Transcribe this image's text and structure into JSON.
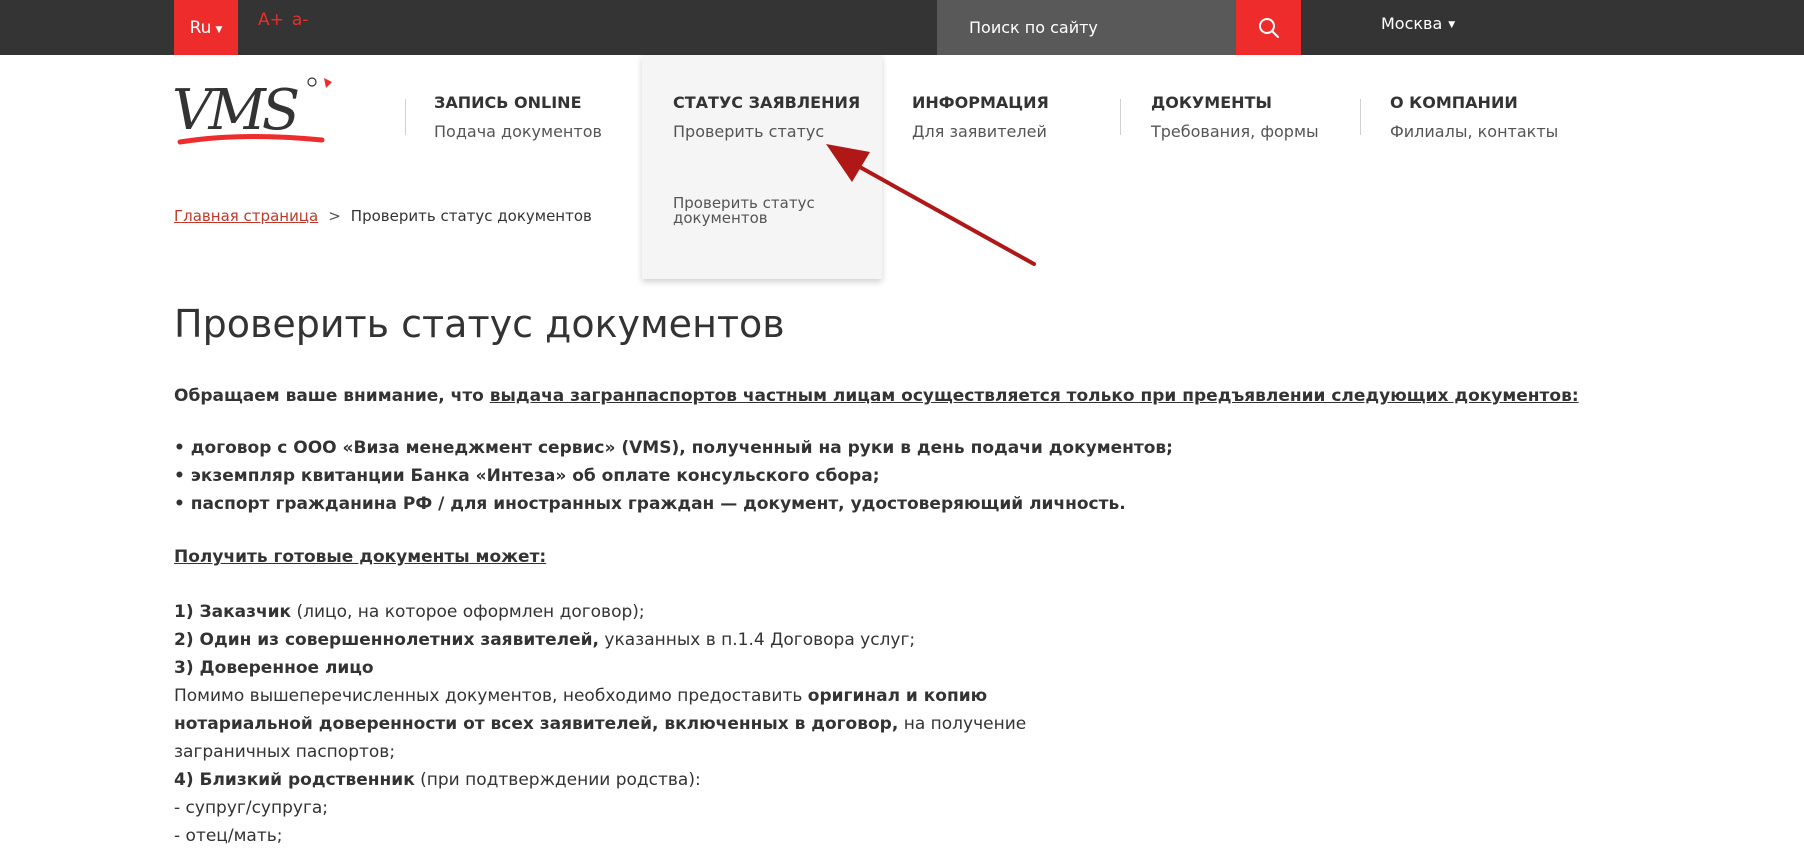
{
  "topbar": {
    "lang": "Ru",
    "font_increase": "A+",
    "font_decrease": "a-",
    "search_placeholder": "Поиск по сайту",
    "city": "Москва"
  },
  "colors": {
    "accent": "#ee2c2c",
    "topbar": "#343434",
    "search_bg": "#595959"
  },
  "logo_text": "VMS",
  "nav": [
    {
      "title": "ЗАПИСЬ ONLINE",
      "sub": "Подача документов"
    },
    {
      "title": "СТАТУС ЗАЯВЛЕНИЯ",
      "sub": "Проверить статус"
    },
    {
      "title": "ИНФОРМАЦИЯ",
      "sub": "Для заявителей"
    },
    {
      "title": "ДОКУМЕНТЫ",
      "sub": "Требования, формы"
    },
    {
      "title": "О КОМПАНИИ",
      "sub": "Филиалы, контакты"
    }
  ],
  "dropdown": {
    "link": "Проверить статус документов"
  },
  "breadcrumb": {
    "home": "Главная страница",
    "sep": ">",
    "current": "Проверить статус документов"
  },
  "page_title": "Проверить статус документов",
  "content": {
    "notice_prefix": "Обращаем ваше внимание, что ",
    "notice_link": "выдача загранпаспортов частным лицам осуществляется только при предъявлении следующих документов:",
    "bullets": [
      "• договор с ООО «Виза менеджмент сервис» (VMS), полученный на руки в день подачи документов;",
      "• экземпляр квитанции Банка «Интеза» об оплате консульского сбора;",
      "• паспорт гражданина РФ / для иностранных граждан — документ, удостоверяющий личность."
    ],
    "who_heading": "Получить готовые документы может:",
    "item1_bold": "1) Заказчик",
    "item1_rest": " (лицо, на которое оформлен договор);",
    "item2_bold": "2) Один из совершеннолетних заявителей,",
    "item2_rest": " указанных в п.1.4 Договора услуг;",
    "item3_bold": "3) Доверенное лицо",
    "item3_desc1": "Помимо вышеперечисленных документов, необходимо предоставить ",
    "item3_desc1_bold": "оригинал и копию",
    "item3_desc2_bold": "нотариальной доверенности от всех заявителей, включенных в договор,",
    "item3_desc2_rest": " на получение",
    "item3_desc3": "заграничных паспортов;",
    "item4_bold": "4) Близкий родственник",
    "item4_rest": " (при подтверждении родства):",
    "rel1": "- супруг/супруга;",
    "rel2": "- отец/мать;"
  }
}
